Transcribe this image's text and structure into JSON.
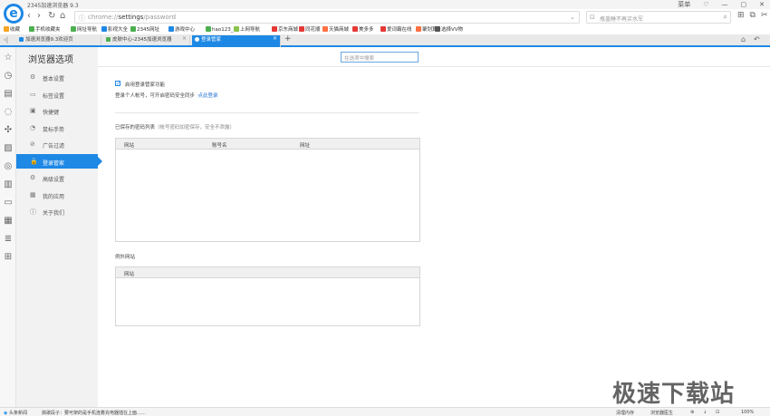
{
  "window": {
    "title": "2345加速浏览器 9.3",
    "controls": [
      "菜单",
      "♡",
      "—",
      "▢",
      "✕"
    ]
  },
  "toolbar": {
    "back": "‹",
    "forward": "›",
    "reload": "↻",
    "home": "⌂",
    "url_prefix": "chrome://",
    "url_path": "settings",
    "url_suffix": "/password",
    "search_placeholder": "瓶盖睡不再买水军",
    "tool_icons": [
      "⊞",
      "⧉",
      "✂",
      "≡"
    ]
  },
  "bookmarks": [
    {
      "label": "收藏",
      "color": "#f5a623"
    },
    {
      "label": "手机收藏夹",
      "color": "#4caf50"
    },
    {
      "label": "网址导航",
      "color": "#4caf50"
    },
    {
      "label": "影视大全",
      "color": "#1e88e5"
    },
    {
      "label": "2345网址",
      "color": "#4caf50"
    },
    {
      "label": "游戏中心",
      "color": "#1e88e5"
    },
    {
      "label": "hao123_上",
      "color": "#4caf50"
    },
    {
      "label": "上网导航",
      "color": "#8bc34a"
    },
    {
      "label": "京东商城",
      "color": "#e53935"
    },
    {
      "label": "同花顺",
      "color": "#e53935"
    },
    {
      "label": "天猫商城",
      "color": "#ff7043"
    },
    {
      "label": "美多多",
      "color": "#e53935"
    },
    {
      "label": "爱词霸在线",
      "color": "#e53935"
    },
    {
      "label": "聚划算",
      "color": "#ff7043"
    },
    {
      "label": "选择VV物",
      "color": "#555555"
    }
  ],
  "tabs": [
    {
      "label": "加速浏览器9.3欢迎页",
      "active": false,
      "color": "#1e88e5"
    },
    {
      "label": "皮肤中心-2345加速浏览器",
      "active": false,
      "color": "#4caf50"
    },
    {
      "label": "登录管家",
      "active": true,
      "color": "#ffffff"
    }
  ],
  "new_tab": "+",
  "sidebar_icons": [
    "star-icon",
    "history-icon",
    "calendar-icon",
    "chat-icon",
    "game-icon",
    "picture-icon",
    "controller-icon",
    "film-icon",
    "card-icon",
    "calculator-icon",
    "note-icon",
    "apps-icon"
  ],
  "settings": {
    "title": "浏览器选项",
    "search_placeholder": "在选项中搜索",
    "nav": [
      {
        "label": "基本设置",
        "icon": "⚙"
      },
      {
        "label": "标签设置",
        "icon": "▭"
      },
      {
        "label": "快捷键",
        "icon": "▣"
      },
      {
        "label": "鼠标手势",
        "icon": "◔"
      },
      {
        "label": "广告过滤",
        "icon": "⊘"
      },
      {
        "label": "登录管家",
        "icon": "🔒"
      },
      {
        "label": "高级设置",
        "icon": "⚙"
      },
      {
        "label": "我的应用",
        "icon": "▦"
      },
      {
        "label": "关于我们",
        "icon": "ⓘ"
      }
    ],
    "active_index": 5
  },
  "content": {
    "enable_label": "启用登录管家功能",
    "enable_checked": true,
    "login_text": "登录个人帐号，可开启密码安全同步",
    "login_link": "点此登录",
    "saved_title": "已保存的密码列表",
    "saved_note": "（帐号密码加密保存，安全不泄露）",
    "saved_headers": [
      "网站",
      "账号名",
      "网址"
    ],
    "except_title": "例外网站",
    "except_headers": [
      "网站"
    ]
  },
  "status": {
    "news": "头条新闻",
    "headline": "搞歌段子：要可架的是手机连着充电器插在上面……",
    "items": [
      "清理内存",
      "浏览器医生",
      "⊕",
      "↓",
      "⊡",
      "100%"
    ]
  },
  "watermark": "极速下载站"
}
